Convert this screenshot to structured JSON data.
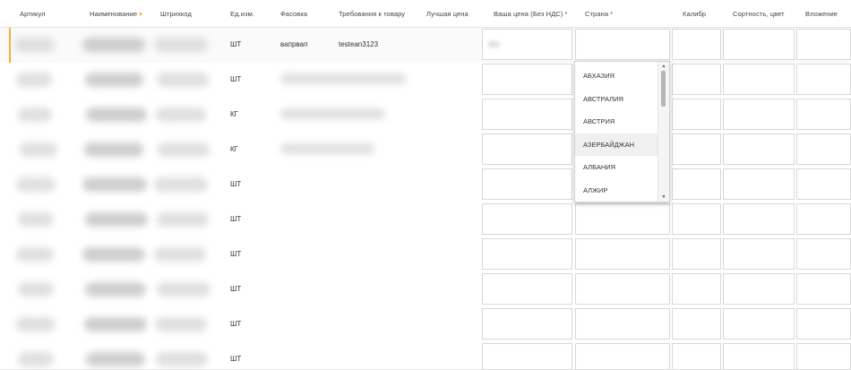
{
  "header": {
    "article": "Артикул",
    "name": "Наименование",
    "name_sort_icon": "sort-desc-arrow",
    "barcode": "Штрихкод",
    "unit": "Ед.изм.",
    "packing": "Фасовка",
    "requirements": "Требования к товару",
    "best_price": "Лучшая цена",
    "your_price": "Ваша цена (Без НДС)",
    "country": "Страна",
    "caliber": "Калибр",
    "grade": "Сортность, цвет",
    "attachment": "Вложение",
    "required_mark": "*"
  },
  "rows": [
    {
      "unit": "ШТ",
      "packing": "вапрвап",
      "requirements": "testean3123"
    },
    {
      "unit": "ШТ",
      "packing": "",
      "requirements": ""
    },
    {
      "unit": "КГ",
      "packing": "",
      "requirements": ""
    },
    {
      "unit": "КГ",
      "packing": "",
      "requirements": ""
    },
    {
      "unit": "ШТ",
      "packing": "",
      "requirements": ""
    },
    {
      "unit": "ШТ",
      "packing": "",
      "requirements": ""
    },
    {
      "unit": "ШТ",
      "packing": "",
      "requirements": ""
    },
    {
      "unit": "ШТ",
      "packing": "",
      "requirements": ""
    },
    {
      "unit": "ШТ",
      "packing": "",
      "requirements": ""
    },
    {
      "unit": "ШТ",
      "packing": "",
      "requirements": ""
    }
  ],
  "country_dropdown": {
    "options": [
      "АБХАЗИЯ",
      "АВСТРАЛИЯ",
      "АВСТРИЯ",
      "АЗЕРБАЙДЖАН",
      "АЛБАНИЯ",
      "АЛЖИР"
    ],
    "highlighted": "АЗЕРБАЙДЖАН"
  },
  "colors": {
    "accent": "#f2b233",
    "border": "#d8d8d8"
  }
}
